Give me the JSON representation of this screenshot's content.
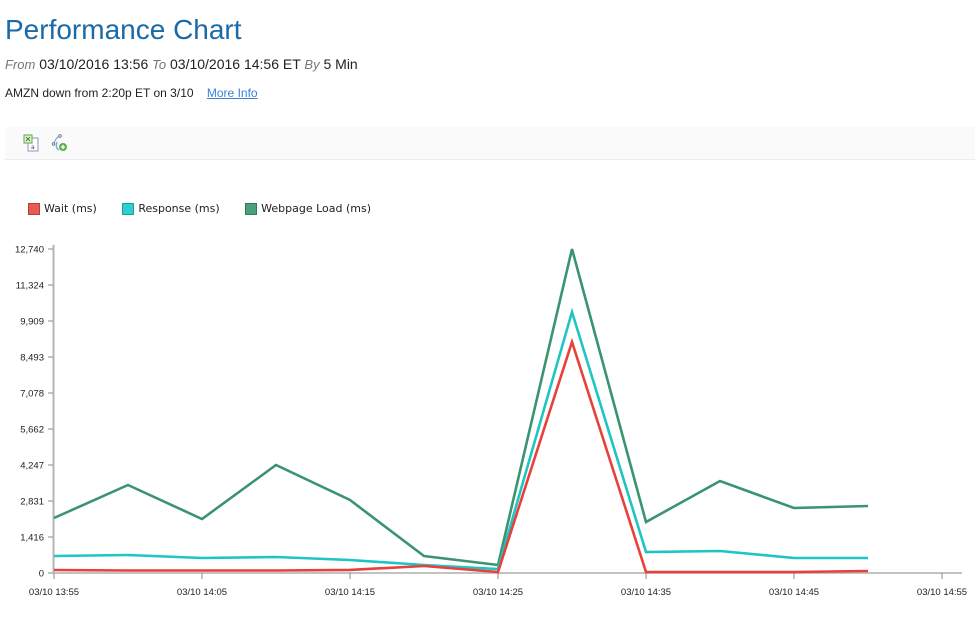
{
  "header": {
    "title": "Performance Chart",
    "range": {
      "from_label": "From",
      "from_value": "03/10/2016 13:56",
      "to_label": "To",
      "to_value": "03/10/2016 14:56 ET",
      "by_label": "By",
      "by_value": "5 Min"
    },
    "notice": "AMZN down from 2:20p ET on 3/10",
    "more_info_link": "More Info"
  },
  "toolbar": {
    "buttons": [
      {
        "icon": "export-excel-icon"
      },
      {
        "icon": "add-series-icon"
      }
    ]
  },
  "chart_data": {
    "type": "line",
    "title": "",
    "xlabel": "",
    "ylabel": "",
    "legend_position": "top-left",
    "grid": false,
    "ylim": [
      0,
      12740
    ],
    "y_ticks": [
      0,
      1416,
      2831,
      4247,
      5662,
      7078,
      8493,
      9909,
      11324,
      12740
    ],
    "y_tick_labels": [
      "0",
      "1,416",
      "2,831",
      "4,247",
      "5,662",
      "7,078",
      "8,493",
      "9,909",
      "11,324",
      "12,740"
    ],
    "x_range_minutes": [
      0,
      60
    ],
    "x_ticks_minutes": [
      0,
      10,
      20,
      30,
      40,
      50,
      60
    ],
    "x_tick_labels": [
      "03/10 13:55",
      "03/10 14:05",
      "03/10 14:15",
      "03/10 14:25",
      "03/10 14:35",
      "03/10 14:45",
      "03/10 14:55"
    ],
    "x": [
      "13:55",
      "14:00",
      "14:05",
      "14:10",
      "14:15",
      "14:20",
      "14:25",
      "14:30",
      "14:35",
      "14:40",
      "14:45",
      "14:50"
    ],
    "x_minutes": [
      0,
      5,
      10,
      15,
      20,
      25,
      30,
      35,
      40,
      45,
      50,
      55
    ],
    "series": [
      {
        "name": "Wait (ms)",
        "color": "#e8403a",
        "values": [
          118,
          100,
          100,
          100,
          120,
          275,
          40,
          9083,
          40,
          40,
          40,
          79
        ]
      },
      {
        "name": "Response (ms)",
        "color": "#1fc4c4",
        "values": [
          668,
          708,
          590,
          630,
          510,
          315,
          157,
          10263,
          826,
          865,
          590,
          590
        ]
      },
      {
        "name": "Webpage Load (ms)",
        "color": "#3a9470",
        "values": [
          2163,
          3460,
          2123,
          4247,
          2870,
          668,
          315,
          12740,
          2005,
          3618,
          2556,
          2634
        ]
      }
    ]
  }
}
